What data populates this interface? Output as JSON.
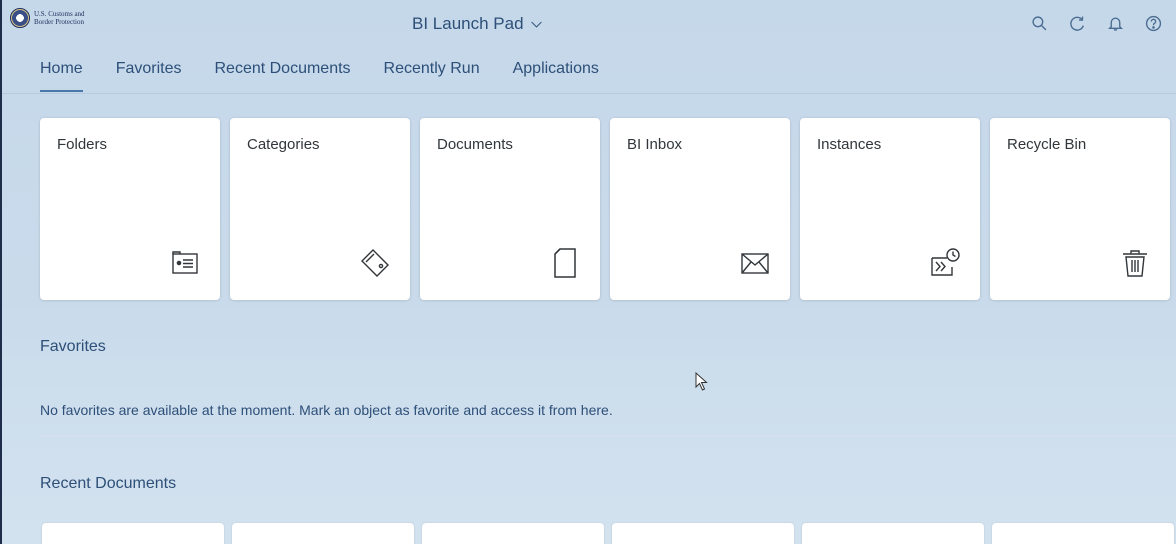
{
  "shell": {
    "logo_line1": "U.S. Customs and",
    "logo_line2": "Border Protection",
    "title": "BI Launch Pad",
    "actions": [
      {
        "name": "search-icon",
        "label": "Search"
      },
      {
        "name": "refresh-icon",
        "label": "Refresh"
      },
      {
        "name": "notification-bell-icon",
        "label": "Notifications"
      },
      {
        "name": "help-icon",
        "label": "Help"
      }
    ]
  },
  "tabs": [
    {
      "label": "Home",
      "active": true
    },
    {
      "label": "Favorites",
      "active": false
    },
    {
      "label": "Recent Documents",
      "active": false
    },
    {
      "label": "Recently Run",
      "active": false
    },
    {
      "label": "Applications",
      "active": false
    }
  ],
  "tiles": [
    {
      "label": "Folders",
      "icon": "folder-icon"
    },
    {
      "label": "Categories",
      "icon": "tag-icon"
    },
    {
      "label": "Documents",
      "icon": "document-icon"
    },
    {
      "label": "BI Inbox",
      "icon": "envelope-icon"
    },
    {
      "label": "Instances",
      "icon": "instances-schedule-icon"
    },
    {
      "label": "Recycle Bin",
      "icon": "trash-icon"
    }
  ],
  "favorites": {
    "title": "Favorites",
    "empty_message": "No favorites are available at the moment. Mark an object as favorite and access it from here."
  },
  "recent_documents": {
    "title": "Recent Documents"
  },
  "colors": {
    "accent": "#2d4f78",
    "background": "#c9dbeb",
    "tile": "#ffffff"
  }
}
